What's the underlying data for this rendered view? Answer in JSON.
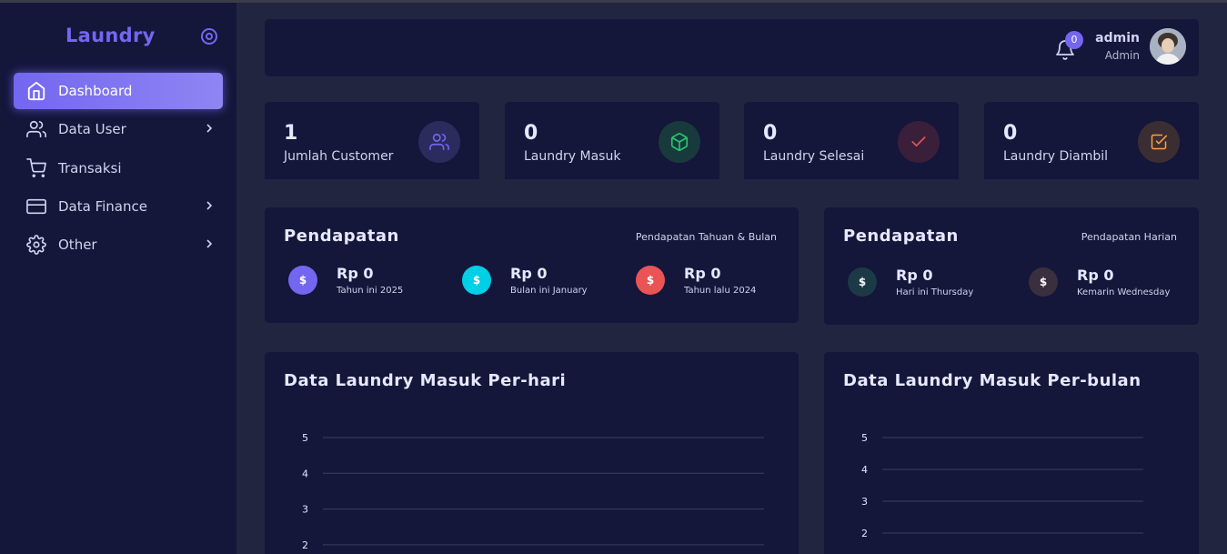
{
  "sidebar": {
    "brand": "Laundry",
    "items": [
      {
        "label": "Dashboard",
        "icon": "home-icon",
        "active": true,
        "chevron": false
      },
      {
        "label": "Data User",
        "icon": "users-icon",
        "active": false,
        "chevron": true
      },
      {
        "label": "Transaksi",
        "icon": "cart-icon",
        "active": false,
        "chevron": false
      },
      {
        "label": "Data Finance",
        "icon": "credit-card-icon",
        "active": false,
        "chevron": true
      },
      {
        "label": "Other",
        "icon": "gear-icon",
        "active": false,
        "chevron": true
      }
    ]
  },
  "header": {
    "notification_count": "0",
    "user_name": "admin",
    "user_role": "Admin"
  },
  "stats": [
    {
      "value": "1",
      "label": "Jumlah Customer",
      "icon": "users-icon",
      "color": "#7367f0"
    },
    {
      "value": "0",
      "label": "Laundry Masuk",
      "icon": "box-icon",
      "color": "#28c76f"
    },
    {
      "value": "0",
      "label": "Laundry Selesai",
      "icon": "check-icon",
      "color": "#ea5455"
    },
    {
      "value": "0",
      "label": "Laundry Diambil",
      "icon": "check-square-icon",
      "color": "#ff9f43"
    }
  ],
  "revenue_yearly": {
    "title": "Pendapatan",
    "subtitle": "Pendapatan Tahuan & Bulan",
    "items": [
      {
        "amount": "Rp 0",
        "caption": "Tahun ini 2025",
        "color": "#7367f0"
      },
      {
        "amount": "Rp 0",
        "caption": "Bulan ini January",
        "color": "#00cfe8"
      },
      {
        "amount": "Rp 0",
        "caption": "Tahun lalu 2024",
        "color": "#ea5455"
      }
    ]
  },
  "revenue_daily": {
    "title": "Pendapatan",
    "subtitle": "Pendapatan Harian",
    "items": [
      {
        "amount": "Rp 0",
        "caption": "Hari ini Thursday",
        "color": "#1b3a45"
      },
      {
        "amount": "Rp 0",
        "caption": "Kemarin Wednesday",
        "color": "#3a2f3f"
      }
    ]
  },
  "chart_data": [
    {
      "type": "line",
      "title": "Data Laundry Masuk Per-hari",
      "ylim": [
        2,
        5
      ],
      "yticks": [
        "5",
        "4",
        "3",
        "2"
      ],
      "grid": true
    },
    {
      "type": "line",
      "title": "Data Laundry Masuk Per-bulan",
      "ylim": [
        2,
        5
      ],
      "yticks": [
        "5",
        "4",
        "3",
        "2"
      ],
      "grid": true
    }
  ],
  "colors": {
    "accent": "#7367f0",
    "sidebar_bg": "#14163a",
    "body_bg": "#22253f"
  }
}
